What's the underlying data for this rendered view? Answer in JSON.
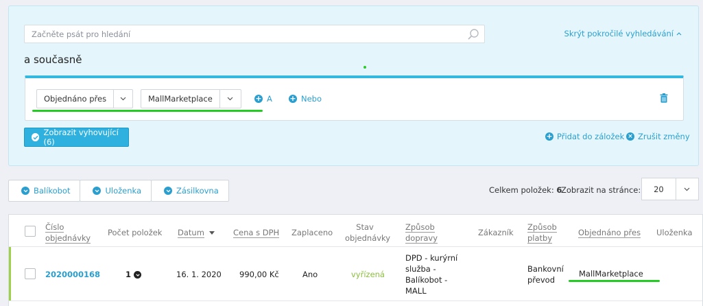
{
  "search": {
    "placeholder": "Začněte psát pro hledání",
    "advanced_toggle": "Skrýt pokročilé vyhledávání",
    "and_title": "a současně",
    "condition": {
      "field": "Objednáno přes",
      "value": "MallMarketplace",
      "add_and": "A",
      "add_or": "Nebo"
    },
    "show_button": "Zobrazit vyhovující (6)",
    "add_bookmark": "Přidat do záložek",
    "cancel_changes": "Zrušit změny"
  },
  "tabs": [
    {
      "label": "Balíkobot"
    },
    {
      "label": "Uloženka"
    },
    {
      "label": "Zásilkovna"
    }
  ],
  "pagination": {
    "total_label": "Celkem položek:",
    "total_count": "6",
    "per_page_label": "Zobrazit na stránce:",
    "per_page_value": "20"
  },
  "table": {
    "headers": {
      "order_number_1": "Číslo",
      "order_number_2": "objednávky",
      "item_count": "Počet položek",
      "date": "Datum",
      "price": "Cena s DPH",
      "paid": "Zaplaceno",
      "status_1": "Stav",
      "status_2": "objednávky",
      "shipping_1": "Způsob",
      "shipping_2": "dopravy",
      "customer": "Zákazník",
      "payment_1": "Způsob",
      "payment_2": "platby",
      "ordered_via": "Objednáno přes",
      "ulozenka": "Uloženka"
    },
    "rows": [
      {
        "order_number": "2020000168",
        "item_count": "1",
        "date": "16. 1. 2020",
        "price": "990,00 Kč",
        "paid": "Ano",
        "status": "vyřízená",
        "shipping_lines": [
          "DPD - kurýrní",
          "služba -",
          "Balíkobot -",
          "MALL"
        ],
        "customer": "",
        "payment_lines": [
          "Bankovní",
          "převod"
        ],
        "ordered_via": "MallMarketplace",
        "ulozenka": ""
      }
    ]
  },
  "colors": {
    "accent": "#2a9fcf",
    "primary_button": "#2fb1df",
    "highlight_underline": "#22cc22",
    "status_done": "#8cbf3f"
  }
}
